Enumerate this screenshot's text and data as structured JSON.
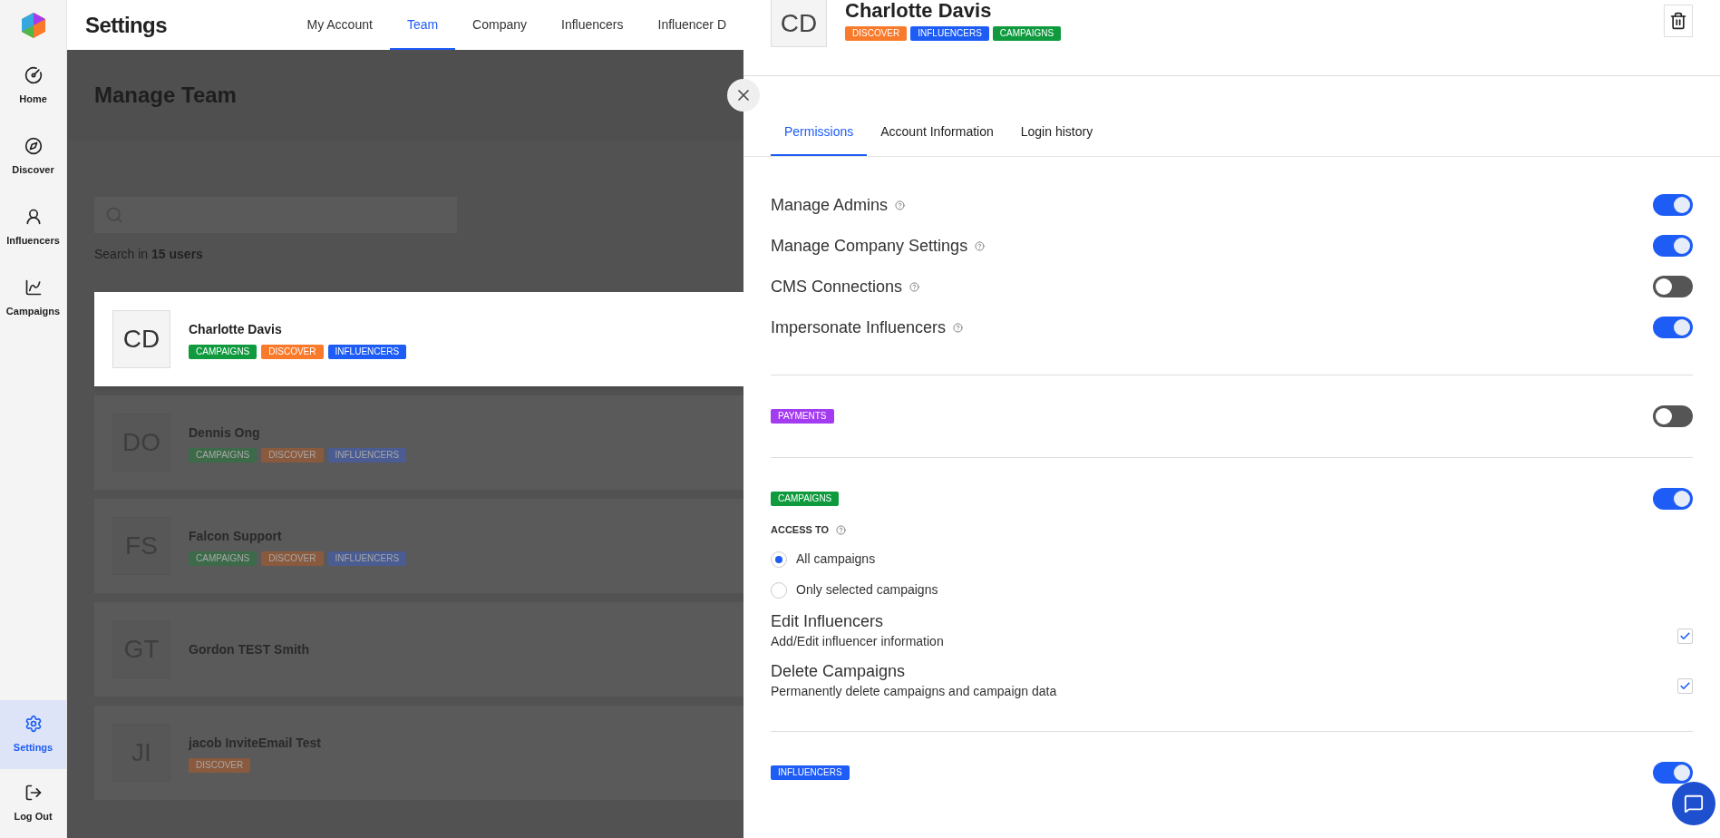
{
  "sidebar": {
    "items": [
      {
        "label": "Home",
        "selected": false
      },
      {
        "label": "Discover",
        "selected": false
      },
      {
        "label": "Influencers",
        "selected": false
      },
      {
        "label": "Campaigns",
        "selected": false
      }
    ],
    "bottom_items": [
      {
        "label": "Settings",
        "selected": true
      },
      {
        "label": "Log Out",
        "selected": false
      }
    ]
  },
  "header": {
    "title": "Settings",
    "tabs": [
      {
        "label": "My Account",
        "selected": false
      },
      {
        "label": "Team",
        "selected": true
      },
      {
        "label": "Company",
        "selected": false
      },
      {
        "label": "Influencers",
        "selected": false
      },
      {
        "label": "Influencer D",
        "selected": false
      }
    ]
  },
  "team": {
    "title": "Manage Team",
    "search_hint": "Search in **15 users**",
    "users": [
      {
        "initials": "CD",
        "name": "Charlotte Davis",
        "selected": true,
        "tags": [
          {
            "label": "CAMPAIGNS",
            "color": "#0f9a3e"
          },
          {
            "label": "DISCOVER",
            "color": "#f97a2b"
          },
          {
            "label": "INFLUENCERS",
            "color": "#1d5cf5"
          }
        ]
      },
      {
        "initials": "DO",
        "name": "Dennis Ong",
        "selected": false,
        "tags": [
          {
            "label": "CAMPAIGNS",
            "color": "#3d6b4a"
          },
          {
            "label": "DISCOVER",
            "color": "#8a5a3e"
          },
          {
            "label": "INFLUENCERS",
            "color": "#4a5c92"
          }
        ]
      },
      {
        "initials": "FS",
        "name": "Falcon Support",
        "selected": false,
        "tags": [
          {
            "label": "CAMPAIGNS",
            "color": "#3d6b4a"
          },
          {
            "label": "DISCOVER",
            "color": "#8a5a3e"
          },
          {
            "label": "INFLUENCERS",
            "color": "#4a5c92"
          }
        ]
      },
      {
        "initials": "GT",
        "name": "Gordon TEST Smith",
        "selected": false
      },
      {
        "initials": "JI",
        "name": "jacob InviteEmail Test",
        "selected": false,
        "tags": [
          {
            "label": "DISCOVER",
            "color": "#8a5a3e"
          }
        ]
      }
    ]
  },
  "panel": {
    "user": {
      "initials": "CD",
      "name": "Charlotte Davis",
      "tags": [
        {
          "label": "DISCOVER",
          "color": "#f97a2b"
        },
        {
          "label": "INFLUENCERS",
          "color": "#1d5cf5"
        },
        {
          "label": "CAMPAIGNS",
          "color": "#0f9a3e"
        }
      ]
    },
    "tabs": [
      {
        "label": "Permissions",
        "selected": true
      },
      {
        "label": "Account Information",
        "selected": false
      },
      {
        "label": "Login history",
        "selected": false
      }
    ],
    "permissions": [
      {
        "label": "Manage Admins",
        "on": true
      },
      {
        "label": "Manage Company Settings",
        "on": true
      },
      {
        "label": "CMS Connections",
        "on": false
      },
      {
        "label": "Impersonate Influencers",
        "on": true
      }
    ],
    "sections": [
      {
        "tag": {
          "label": "PAYMENTS",
          "color": "#a33cf0"
        },
        "on": false
      },
      {
        "tag": {
          "label": "CAMPAIGNS",
          "color": "#0f9a3e"
        },
        "on": true,
        "access": {
          "label": "ACCESS TO",
          "options": [
            {
              "label": "All campaigns",
              "selected": true
            },
            {
              "label": "Only selected campaigns",
              "selected": false
            }
          ]
        },
        "options": [
          {
            "title": "Edit Influencers",
            "description": "Add/Edit influencer information",
            "checked": true
          },
          {
            "title": "Delete Campaigns",
            "description": "Permanently delete campaigns and campaign data",
            "checked": true
          }
        ]
      },
      {
        "tag": {
          "label": "INFLUENCERS",
          "color": "#1d5cf5"
        },
        "on": true
      }
    ]
  }
}
